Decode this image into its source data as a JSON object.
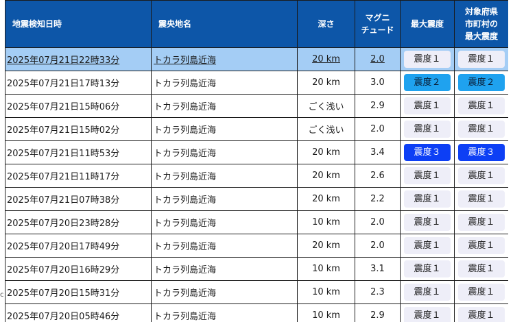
{
  "table": {
    "headers": {
      "time": "地震検知日時",
      "place": "震央地名",
      "depth": "深さ",
      "magnitude": [
        "マグニ",
        "チュード"
      ],
      "maxint": "最大震度",
      "pref": [
        "対象府県",
        "市町村の",
        "最大震度"
      ]
    },
    "rows": [
      {
        "time": "2025年07月21日22時33分",
        "place": "トカラ列島近海",
        "depth": "20 km",
        "mag": "2.0",
        "maxint": "震度１",
        "pref": "震度１",
        "level": 1,
        "selected": true
      },
      {
        "time": "2025年07月21日17時13分",
        "place": "トカラ列島近海",
        "depth": "20 km",
        "mag": "3.0",
        "maxint": "震度２",
        "pref": "震度２",
        "level": 2
      },
      {
        "time": "2025年07月21日15時06分",
        "place": "トカラ列島近海",
        "depth": "ごく浅い",
        "mag": "2.9",
        "maxint": "震度１",
        "pref": "震度１",
        "level": 1
      },
      {
        "time": "2025年07月21日15時02分",
        "place": "トカラ列島近海",
        "depth": "ごく浅い",
        "mag": "2.0",
        "maxint": "震度１",
        "pref": "震度１",
        "level": 1
      },
      {
        "time": "2025年07月21日11時53分",
        "place": "トカラ列島近海",
        "depth": "20 km",
        "mag": "3.4",
        "maxint": "震度３",
        "pref": "震度３",
        "level": 3
      },
      {
        "time": "2025年07月21日11時17分",
        "place": "トカラ列島近海",
        "depth": "20 km",
        "mag": "2.6",
        "maxint": "震度１",
        "pref": "震度１",
        "level": 1
      },
      {
        "time": "2025年07月21日07時38分",
        "place": "トカラ列島近海",
        "depth": "20 km",
        "mag": "2.2",
        "maxint": "震度１",
        "pref": "震度１",
        "level": 1
      },
      {
        "time": "2025年07月20日23時28分",
        "place": "トカラ列島近海",
        "depth": "10 km",
        "mag": "2.0",
        "maxint": "震度１",
        "pref": "震度１",
        "level": 1
      },
      {
        "time": "2025年07月20日17時49分",
        "place": "トカラ列島近海",
        "depth": "20 km",
        "mag": "2.0",
        "maxint": "震度１",
        "pref": "震度１",
        "level": 1
      },
      {
        "time": "2025年07月20日16時29分",
        "place": "トカラ列島近海",
        "depth": "10 km",
        "mag": "3.1",
        "maxint": "震度１",
        "pref": "震度１",
        "level": 1
      },
      {
        "time": "2025年07月20日15時31分",
        "place": "トカラ列島近海",
        "depth": "10 km",
        "mag": "2.3",
        "maxint": "震度１",
        "pref": "震度１",
        "level": 1
      },
      {
        "time": "2025年07月20日05時46分",
        "place": "トカラ列島近海",
        "depth": "10 km",
        "mag": "2.9",
        "maxint": "震度１",
        "pref": "震度１",
        "level": 1
      }
    ]
  },
  "colors": {
    "header_bg": "#0d56a8",
    "selected_row": "#a4cdf5",
    "intensity_1": "#eeeef8",
    "intensity_2": "#1fa2ef",
    "intensity_3": "#0d3ff5"
  },
  "edge_glyph": "c"
}
